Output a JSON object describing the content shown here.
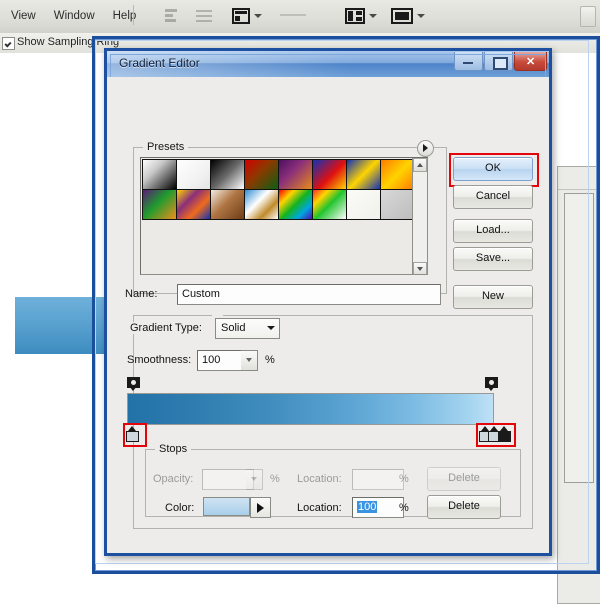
{
  "app": {
    "menu": [
      "View",
      "Window",
      "Help"
    ],
    "options_bar": {
      "show_sampling_ring_label": "Show Sampling Ring",
      "checked": true
    }
  },
  "dialog": {
    "title": "Gradient Editor",
    "window_buttons": {
      "minimize": "minimize-icon",
      "maximize": "maximize-icon",
      "close": "✕"
    },
    "presets": {
      "label": "Presets",
      "flyout_icon": "flyout-triangle-icon",
      "swatches": [
        {
          "name": "foreground-to-background",
          "css": "linear-gradient(135deg,#ffffff 0%,#c9c9c9 35%,#000000 100%)"
        },
        {
          "name": "foreground-to-transparent",
          "css": "linear-gradient(135deg,#ffffff 0%,#f2f2f2 60%,#e4e4e4 100%)"
        },
        {
          "name": "black-white",
          "css": "linear-gradient(135deg,#000000 0%,#6a6a6a 50%,#ffffff 100%)"
        },
        {
          "name": "red-green",
          "css": "linear-gradient(135deg,#d40000 0%,#8a3a00 45%,#0b5f14 100%)"
        },
        {
          "name": "violet-orange",
          "css": "linear-gradient(135deg,#4b1060 0%,#8a2f7a 40%,#e88b1a 100%)"
        },
        {
          "name": "blue-red-yellow",
          "css": "linear-gradient(135deg,#1332b4 0%,#e01010 55%,#ffd400 100%)"
        },
        {
          "name": "blue-yellow-blue",
          "css": "linear-gradient(135deg,#1332b4 0%,#ffd400 50%,#1332b4 100%)"
        },
        {
          "name": "orange-yellow-orange",
          "css": "linear-gradient(135deg,#ff7a00 0%,#ffd400 50%,#ff7a00 100%)"
        },
        {
          "name": "violet-green-orange",
          "css": "linear-gradient(135deg,#5a1c78 0%,#1f9b2e 45%,#ef8f1c 100%)"
        },
        {
          "name": "yellow-violet-orange-blue",
          "css": "linear-gradient(135deg,#ffd400 0%,#8a2f7a 35%,#ef6b1c 65%,#1332b4 100%)"
        },
        {
          "name": "copper",
          "css": "linear-gradient(135deg,#f3ece2 0%,#b07644 45%,#6d3c16 100%)"
        },
        {
          "name": "chrome",
          "css": "linear-gradient(135deg,#2f8fd4 0%,#ffffff 40%,#c08a2a 70%,#ffffff 100%)"
        },
        {
          "name": "spectrum",
          "css": "linear-gradient(135deg,#ff0000 0%,#ffd400 25%,#12b41f 50%,#00a6e0 75%,#4b10b4 100%)"
        },
        {
          "name": "transparent-rainbow",
          "css": "linear-gradient(135deg,#ff2a2a 0%,#ffd400 25%,#21c42d 50%,#ffffff 100%)"
        },
        {
          "name": "transparent-stripes",
          "css": "linear-gradient(135deg,#fbfbf7 0%,#f1f1ec 100%)"
        },
        {
          "name": "neutral-density",
          "css": "linear-gradient(135deg,#d8d8d8 0%,#bdbdbd 100%)"
        }
      ]
    },
    "name": {
      "label": "Name:",
      "value": "Custom",
      "new_button": "New"
    },
    "buttons": {
      "ok": "OK",
      "cancel": "Cancel",
      "load": "Load...",
      "save": "Save..."
    },
    "gradient_type": {
      "label": "Gradient Type:",
      "value": "Solid"
    },
    "smoothness": {
      "label": "Smoothness:",
      "value": "100",
      "unit": "%"
    },
    "gradient_preview": {
      "css": "linear-gradient(90deg,#2272a8 0%,#2f7cb0 18%,#3f8cbd 38%,#5aa3d2 60%,#7cbbe3 78%,#a3d3ef 93%,#bfe0f6 100%)",
      "left_stop_top_location": "0",
      "right_stop_top_location": "100"
    },
    "stops": {
      "label": "Stops",
      "opacity_label": "Opacity:",
      "opacity_value": "",
      "opacity_unit": "%",
      "location_label_top": "Location:",
      "location_value_top": "",
      "location_unit_top": "%",
      "delete_top": "Delete",
      "color_label": "Color:",
      "color_swatch": "#a9cfea",
      "location_label_bottom": "Location:",
      "location_value_bottom": "100",
      "location_unit_bottom": "%",
      "delete_bottom": "Delete"
    }
  },
  "colors": {
    "highlight": "#e4050b",
    "dialog_border": "#1d50a0",
    "title_gradient_start": "#a9c8ec",
    "accent_blue": "#3a93e0"
  }
}
